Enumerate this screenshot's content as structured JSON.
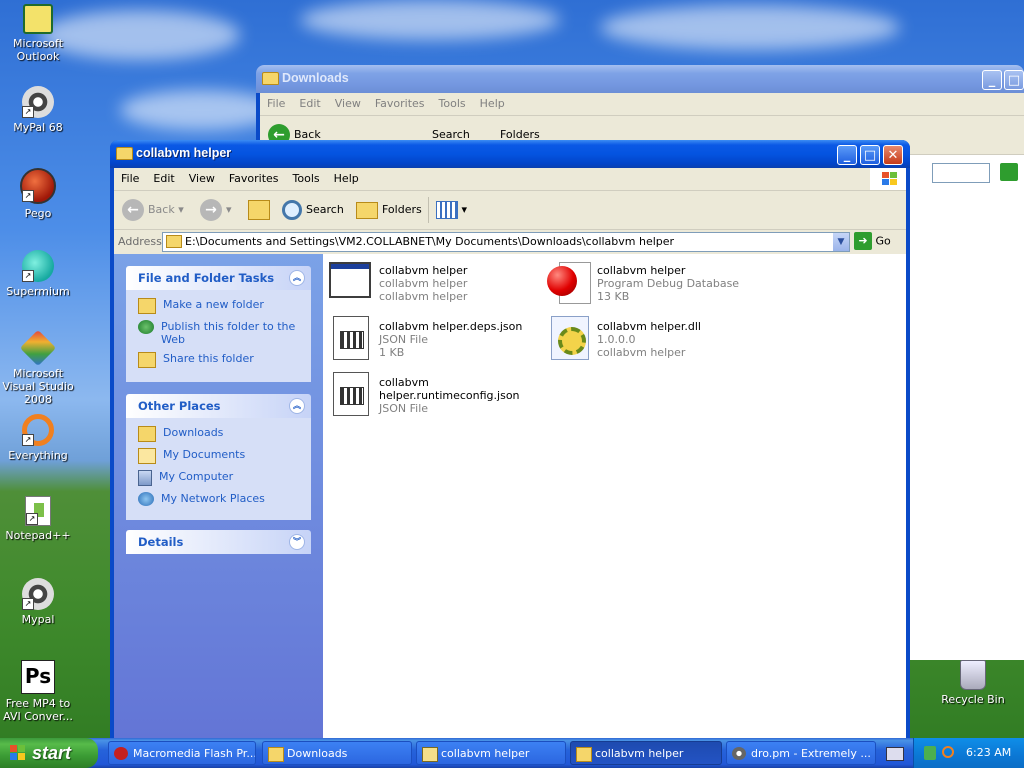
{
  "desktop": {
    "icons": [
      {
        "label": "Microsoft Outlook"
      },
      {
        "label": "MyPal 68"
      },
      {
        "label": "Pego"
      },
      {
        "label": "Supermium"
      },
      {
        "label": "Microsoft Visual Studio 2008"
      },
      {
        "label": "Everything"
      },
      {
        "label": "Notepad++"
      },
      {
        "label": "Mypal"
      },
      {
        "label": "Free MP4 to AVI Conver..."
      },
      {
        "label": "Recycle Bin"
      }
    ]
  },
  "back_window": {
    "title": "Downloads",
    "menu": [
      "File",
      "Edit",
      "View",
      "Favorites",
      "Tools",
      "Help"
    ],
    "toolbar": {
      "back": "Back",
      "search": "Search",
      "folders": "Folders"
    }
  },
  "window": {
    "title": "collabvm helper",
    "menu": [
      "File",
      "Edit",
      "View",
      "Favorites",
      "Tools",
      "Help"
    ],
    "toolbar": {
      "back": "Back",
      "search": "Search",
      "folders": "Folders"
    },
    "address": {
      "label": "Address",
      "value": "E:\\Documents and Settings\\VM2.COLLABNET\\My Documents\\Downloads\\collabvm helper",
      "go": "Go"
    },
    "tasks": {
      "file_folder_tasks": {
        "title": "File and Folder Tasks",
        "links": [
          "Make a new folder",
          "Publish this folder to the Web",
          "Share this folder"
        ]
      },
      "other_places": {
        "title": "Other Places",
        "links": [
          "Downloads",
          "My Documents",
          "My Computer",
          "My Network Places"
        ]
      },
      "details": {
        "title": "Details"
      }
    },
    "files": [
      {
        "name": "collabvm helper",
        "line2": "collabvm helper",
        "line3": "collabvm helper",
        "icon": "application-icon"
      },
      {
        "name": "collabvm helper",
        "line2": "Program Debug Database",
        "line3": "13 KB",
        "icon": "pdb-icon"
      },
      {
        "name": "collabvm helper.deps.json",
        "line2": "JSON File",
        "line3": "1 KB",
        "icon": "json-file-icon"
      },
      {
        "name": "collabvm helper.dll",
        "line2": "1.0.0.0",
        "line3": "collabvm helper",
        "icon": "dll-icon"
      },
      {
        "name": "collabvm",
        "name2": "helper.runtimeconfig.json",
        "line2": "JSON File",
        "icon": "json-file-icon"
      }
    ]
  },
  "taskbar": {
    "start": "start",
    "items": [
      {
        "label": "Macromedia Flash Pr..."
      },
      {
        "label": "Downloads"
      },
      {
        "label": "collabvm helper"
      },
      {
        "label": "collabvm helper"
      },
      {
        "label": "dro.pm - Extremely ..."
      }
    ],
    "clock": "6:23 AM"
  }
}
